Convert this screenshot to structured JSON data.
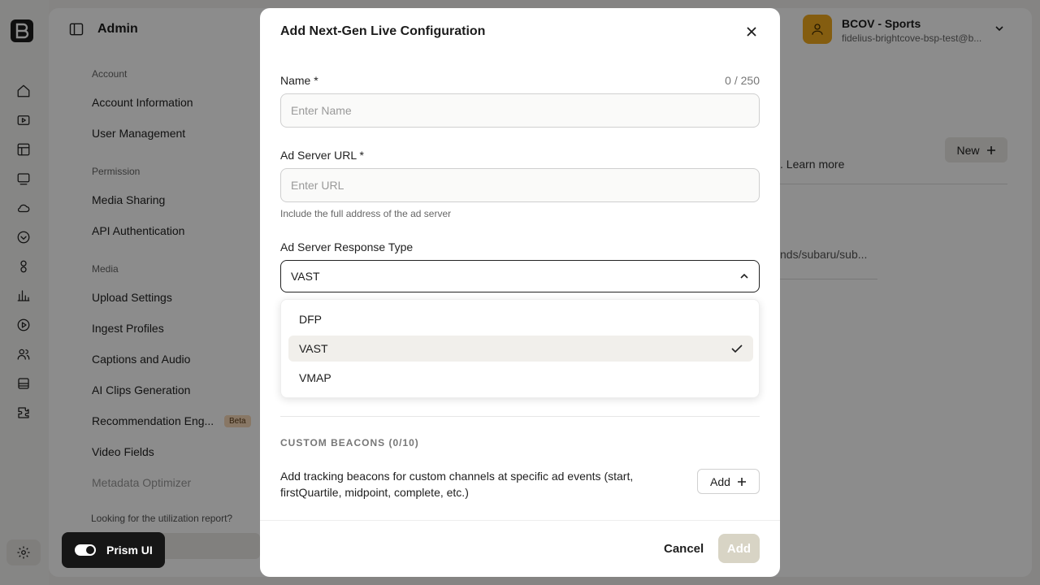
{
  "app": {
    "title": "Admin"
  },
  "account": {
    "name": "BCOV - Sports",
    "email": "fidelius-brightcove-bsp-test@b..."
  },
  "sidebar": {
    "sections": [
      {
        "label": "Account",
        "items": [
          "Account Information",
          "User Management"
        ]
      },
      {
        "label": "Permission",
        "items": [
          "Media Sharing",
          "API Authentication"
        ]
      },
      {
        "label": "Media",
        "items": [
          "Upload Settings",
          "Ingest Profiles",
          "Captions and Audio",
          "AI Clips Generation",
          "Recommendation Eng...",
          "Video Fields",
          "Metadata Optimizer"
        ]
      }
    ],
    "beta_badge": "Beta",
    "utilization_text": "Looking for the utilization report?",
    "prism_label": "Prism UI"
  },
  "background": {
    "new_label": "New",
    "learn_more": ". Learn more",
    "url_fragment": "nds/subaru/sub..."
  },
  "modal": {
    "title": "Add Next-Gen Live Configuration",
    "name_label": "Name *",
    "name_counter": "0 / 250",
    "name_placeholder": "Enter Name",
    "url_label": "Ad Server URL *",
    "url_placeholder": "Enter URL",
    "url_hint": "Include the full address of the ad server",
    "response_label": "Ad Server Response Type",
    "response_value": "VAST",
    "options": [
      "DFP",
      "VAST",
      "VMAP"
    ],
    "selected_option": "VAST",
    "beacons_heading": "CUSTOM BEACONS (0/10)",
    "beacons_desc": "Add tracking beacons for custom channels at specific ad events (start, firstQuartile, midpoint, complete, etc.)",
    "beacons_add": "Add",
    "cancel_label": "Cancel",
    "add_label": "Add"
  },
  "colors": {
    "accent": "#f0a91e",
    "add_disabled": "#d8d4c5",
    "overlay": "#000000"
  }
}
